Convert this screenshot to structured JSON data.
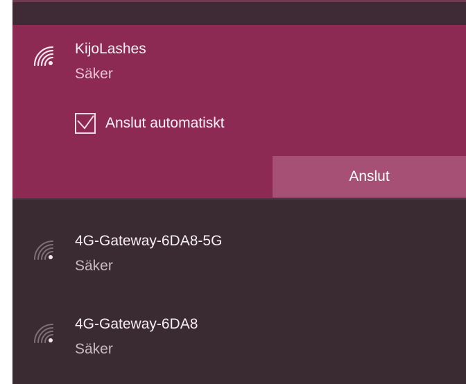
{
  "colors": {
    "accent": "#8d2a54",
    "panel_background": "#3a2a32",
    "button_background": "#a65075"
  },
  "networks": [
    {
      "name": "KijoLashes",
      "status": "Säker",
      "icon": "wifi-icon",
      "selected": true,
      "auto_connect_label": "Anslut automatiskt",
      "auto_connect_checked": true,
      "connect_label": "Anslut"
    },
    {
      "name": "4G-Gateway-6DA8-5G",
      "status": "Säker",
      "icon": "wifi-icon",
      "selected": false
    },
    {
      "name": "4G-Gateway-6DA8",
      "status": "Säker",
      "icon": "wifi-icon",
      "selected": false
    }
  ]
}
